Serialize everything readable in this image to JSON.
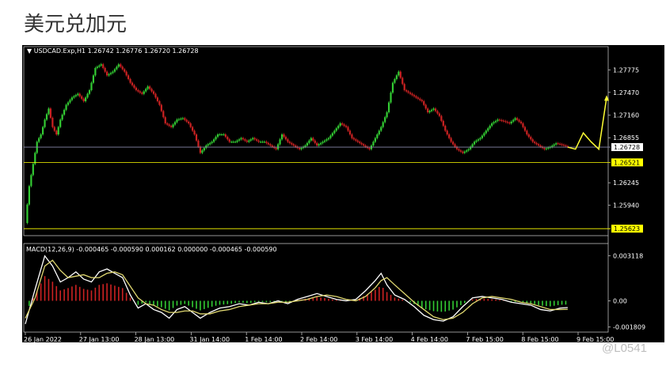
{
  "page": {
    "title": "美元兑加元",
    "watermark": "@L0541"
  },
  "colors": {
    "bg": "#000000",
    "bull": "#33cc33",
    "bear": "#cc2222",
    "macd": "#ffffff",
    "signal": "#e0d870",
    "price_line": "#ffff00",
    "forecast": "#ffff33"
  },
  "chart_data": [
    {
      "type": "candlestick",
      "title": "USDCAD.Exp,H1  1.26742 1.26776 1.26720 1.26728",
      "symbol": "USDCAD.Exp,H1",
      "ohlc_header": "1.26742 1.26776 1.26720 1.26728",
      "ylim": [
        1.2555,
        1.2795
      ],
      "y_ticks": [
        "1.27775",
        "1.27470",
        "1.27160",
        "1.26855",
        "1.26245",
        "1.25940"
      ],
      "y_tick_values": [
        1.27775,
        1.2747,
        1.2716,
        1.26855,
        1.26245,
        1.2594
      ],
      "price_labels": [
        {
          "label": "1.26728",
          "value": 1.26728,
          "style": "current"
        },
        {
          "label": "1.26521",
          "value": 1.26521,
          "style": "level"
        },
        {
          "label": "1.25623",
          "value": 1.25623,
          "style": "level"
        }
      ],
      "x_ticks": [
        "26 Jan 2022",
        "27 Jan 13:00",
        "28 Jan 13:00",
        "31 Jan 14:00",
        "1 Feb 14:00",
        "2 Feb 14:00",
        "3 Feb 14:00",
        "4 Feb 14:00",
        "7 Feb 15:00",
        "8 Feb 15:00",
        "9 Feb 15:00"
      ],
      "close_path": [
        [
          0,
          1.257
        ],
        [
          2,
          1.262
        ],
        [
          4,
          1.265
        ],
        [
          6,
          1.268
        ],
        [
          8,
          1.269
        ],
        [
          10,
          1.271
        ],
        [
          12,
          1.2725
        ],
        [
          14,
          1.27
        ],
        [
          16,
          1.269
        ],
        [
          18,
          1.271
        ],
        [
          21,
          1.273
        ],
        [
          24,
          1.274
        ],
        [
          27,
          1.2745
        ],
        [
          30,
          1.2735
        ],
        [
          33,
          1.275
        ],
        [
          36,
          1.278
        ],
        [
          39,
          1.2785
        ],
        [
          42,
          1.277
        ],
        [
          45,
          1.2775
        ],
        [
          48,
          1.2785
        ],
        [
          51,
          1.2775
        ],
        [
          54,
          1.276
        ],
        [
          57,
          1.275
        ],
        [
          60,
          1.2745
        ],
        [
          63,
          1.2755
        ],
        [
          66,
          1.2745
        ],
        [
          69,
          1.273
        ],
        [
          72,
          1.2705
        ],
        [
          75,
          1.27
        ],
        [
          78,
          1.271
        ],
        [
          81,
          1.2712
        ],
        [
          84,
          1.2705
        ],
        [
          87,
          1.269
        ],
        [
          90,
          1.2665
        ],
        [
          93,
          1.2675
        ],
        [
          96,
          1.268
        ],
        [
          99,
          1.269
        ],
        [
          102,
          1.269
        ],
        [
          105,
          1.268
        ],
        [
          108,
          1.268
        ],
        [
          111,
          1.2685
        ],
        [
          114,
          1.268
        ],
        [
          117,
          1.2685
        ],
        [
          120,
          1.268
        ],
        [
          123,
          1.268
        ],
        [
          126,
          1.2675
        ],
        [
          129,
          1.267
        ],
        [
          132,
          1.269
        ],
        [
          135,
          1.268
        ],
        [
          138,
          1.2675
        ],
        [
          141,
          1.267
        ],
        [
          144,
          1.2675
        ],
        [
          147,
          1.2685
        ],
        [
          150,
          1.2675
        ],
        [
          153,
          1.268
        ],
        [
          156,
          1.2685
        ],
        [
          159,
          1.2695
        ],
        [
          162,
          1.2705
        ],
        [
          165,
          1.27
        ],
        [
          168,
          1.2685
        ],
        [
          171,
          1.268
        ],
        [
          174,
          1.2675
        ],
        [
          177,
          1.267
        ],
        [
          180,
          1.2685
        ],
        [
          183,
          1.27
        ],
        [
          186,
          1.272
        ],
        [
          189,
          1.276
        ],
        [
          192,
          1.2775
        ],
        [
          195,
          1.275
        ],
        [
          198,
          1.2745
        ],
        [
          201,
          1.274
        ],
        [
          204,
          1.2735
        ],
        [
          207,
          1.272
        ],
        [
          210,
          1.2725
        ],
        [
          213,
          1.2715
        ],
        [
          216,
          1.2695
        ],
        [
          219,
          1.268
        ],
        [
          222,
          1.267
        ],
        [
          225,
          1.2665
        ],
        [
          228,
          1.267
        ],
        [
          231,
          1.268
        ],
        [
          234,
          1.2685
        ],
        [
          237,
          1.2695
        ],
        [
          240,
          1.2705
        ],
        [
          243,
          1.271
        ],
        [
          246,
          1.2708
        ],
        [
          249,
          1.2705
        ],
        [
          252,
          1.2712
        ],
        [
          255,
          1.2705
        ],
        [
          258,
          1.269
        ],
        [
          261,
          1.268
        ],
        [
          264,
          1.2675
        ],
        [
          267,
          1.267
        ],
        [
          270,
          1.2673
        ],
        [
          273,
          1.2678
        ],
        [
          276,
          1.2676
        ],
        [
          279,
          1.2673
        ]
      ],
      "forecast_path": [
        [
          279,
          1.26728
        ],
        [
          283,
          1.267
        ],
        [
          287,
          1.2692
        ],
        [
          291,
          1.268
        ],
        [
          295,
          1.267
        ],
        [
          299,
          1.274
        ]
      ]
    },
    {
      "type": "line",
      "title": "MACD(12,26,9) -0.000465 -0.000590 0.000162 0.000000 -0.000465 -0.000590",
      "ylim": [
        -0.00205,
        0.0033
      ],
      "y_ticks": [
        "0.003118",
        "0.00",
        "-0.001809"
      ],
      "y_tick_values": [
        0.003118,
        0.0,
        -0.001809
      ],
      "series": [
        {
          "name": "",
          "style": "macd",
          "points": [
            [
              0,
              -0.0016
            ],
            [
              5,
              0.0008
            ],
            [
              10,
              0.0031
            ],
            [
              14,
              0.0024
            ],
            [
              18,
              0.0013
            ],
            [
              22,
              0.0016
            ],
            [
              26,
              0.002
            ],
            [
              30,
              0.0015
            ],
            [
              34,
              0.0013
            ],
            [
              38,
              0.002
            ],
            [
              42,
              0.0022
            ],
            [
              46,
              0.0019
            ],
            [
              50,
              0.0016
            ],
            [
              54,
              0.0004
            ],
            [
              58,
              -0.0005
            ],
            [
              62,
              -0.0002
            ],
            [
              66,
              -0.0006
            ],
            [
              70,
              -0.0008
            ],
            [
              74,
              -0.0012
            ],
            [
              78,
              -0.0006
            ],
            [
              82,
              -0.0004
            ],
            [
              86,
              -0.0008
            ],
            [
              90,
              -0.0012
            ],
            [
              95,
              -0.0008
            ],
            [
              100,
              -0.0005
            ],
            [
              105,
              -0.0004
            ],
            [
              110,
              -0.0002
            ],
            [
              115,
              -0.0003
            ],
            [
              120,
              -0.0001
            ],
            [
              125,
              -0.0002
            ],
            [
              130,
              0.0
            ],
            [
              135,
              -0.0002
            ],
            [
              140,
              0.0001
            ],
            [
              145,
              0.0003
            ],
            [
              150,
              0.0005
            ],
            [
              155,
              0.0003
            ],
            [
              160,
              0.0001
            ],
            [
              165,
              0.0
            ],
            [
              170,
              0.0001
            ],
            [
              175,
              0.0007
            ],
            [
              180,
              0.0014
            ],
            [
              183,
              0.0019
            ],
            [
              186,
              0.0011
            ],
            [
              190,
              0.0004
            ],
            [
              195,
              0.0001
            ],
            [
              200,
              -0.0004
            ],
            [
              205,
              -0.001
            ],
            [
              210,
              -0.0013
            ],
            [
              215,
              -0.0014
            ],
            [
              220,
              -0.0011
            ],
            [
              225,
              -0.0004
            ],
            [
              230,
              0.0002
            ],
            [
              235,
              0.0003
            ],
            [
              240,
              0.0002
            ],
            [
              245,
              0.0001
            ],
            [
              250,
              -0.0001
            ],
            [
              255,
              -0.0002
            ],
            [
              260,
              -0.0003
            ],
            [
              265,
              -0.0006
            ],
            [
              270,
              -0.0007
            ],
            [
              275,
              -0.0005
            ],
            [
              279,
              -0.000465
            ]
          ]
        },
        {
          "name": "",
          "style": "signal",
          "points": [
            [
              0,
              -0.0012
            ],
            [
              5,
              0.0002
            ],
            [
              10,
              0.0024
            ],
            [
              14,
              0.0028
            ],
            [
              18,
              0.0021
            ],
            [
              22,
              0.0016
            ],
            [
              26,
              0.0017
            ],
            [
              30,
              0.0018
            ],
            [
              34,
              0.0016
            ],
            [
              38,
              0.0016
            ],
            [
              42,
              0.0019
            ],
            [
              46,
              0.002
            ],
            [
              50,
              0.0018
            ],
            [
              54,
              0.001
            ],
            [
              58,
              0.0002
            ],
            [
              62,
              -0.0002
            ],
            [
              66,
              -0.0003
            ],
            [
              70,
              -0.0006
            ],
            [
              74,
              -0.0008
            ],
            [
              78,
              -0.0008
            ],
            [
              82,
              -0.0007
            ],
            [
              86,
              -0.0007
            ],
            [
              90,
              -0.0009
            ],
            [
              95,
              -0.0009
            ],
            [
              100,
              -0.0007
            ],
            [
              105,
              -0.0006
            ],
            [
              110,
              -0.0004
            ],
            [
              115,
              -0.0003
            ],
            [
              120,
              -0.0002
            ],
            [
              125,
              -0.0002
            ],
            [
              130,
              -0.0001
            ],
            [
              135,
              -0.0001
            ],
            [
              140,
              -0.0
            ],
            [
              145,
              0.0001
            ],
            [
              150,
              0.0003
            ],
            [
              155,
              0.0004
            ],
            [
              160,
              0.0003
            ],
            [
              165,
              0.0001
            ],
            [
              170,
              0.0
            ],
            [
              175,
              0.0003
            ],
            [
              180,
              0.0009
            ],
            [
              183,
              0.0014
            ],
            [
              186,
              0.0016
            ],
            [
              190,
              0.0011
            ],
            [
              195,
              0.0005
            ],
            [
              200,
              -0.0001
            ],
            [
              205,
              -0.0006
            ],
            [
              210,
              -0.0011
            ],
            [
              215,
              -0.0013
            ],
            [
              220,
              -0.0012
            ],
            [
              225,
              -0.0008
            ],
            [
              230,
              -0.0002
            ],
            [
              235,
              0.0002
            ],
            [
              240,
              0.0003
            ],
            [
              245,
              0.0002
            ],
            [
              250,
              0.0001
            ],
            [
              255,
              -0.0001
            ],
            [
              260,
              -0.0002
            ],
            [
              265,
              -0.0004
            ],
            [
              270,
              -0.0006
            ],
            [
              275,
              -0.0006
            ],
            [
              279,
              -0.00059
            ]
          ]
        }
      ]
    }
  ]
}
